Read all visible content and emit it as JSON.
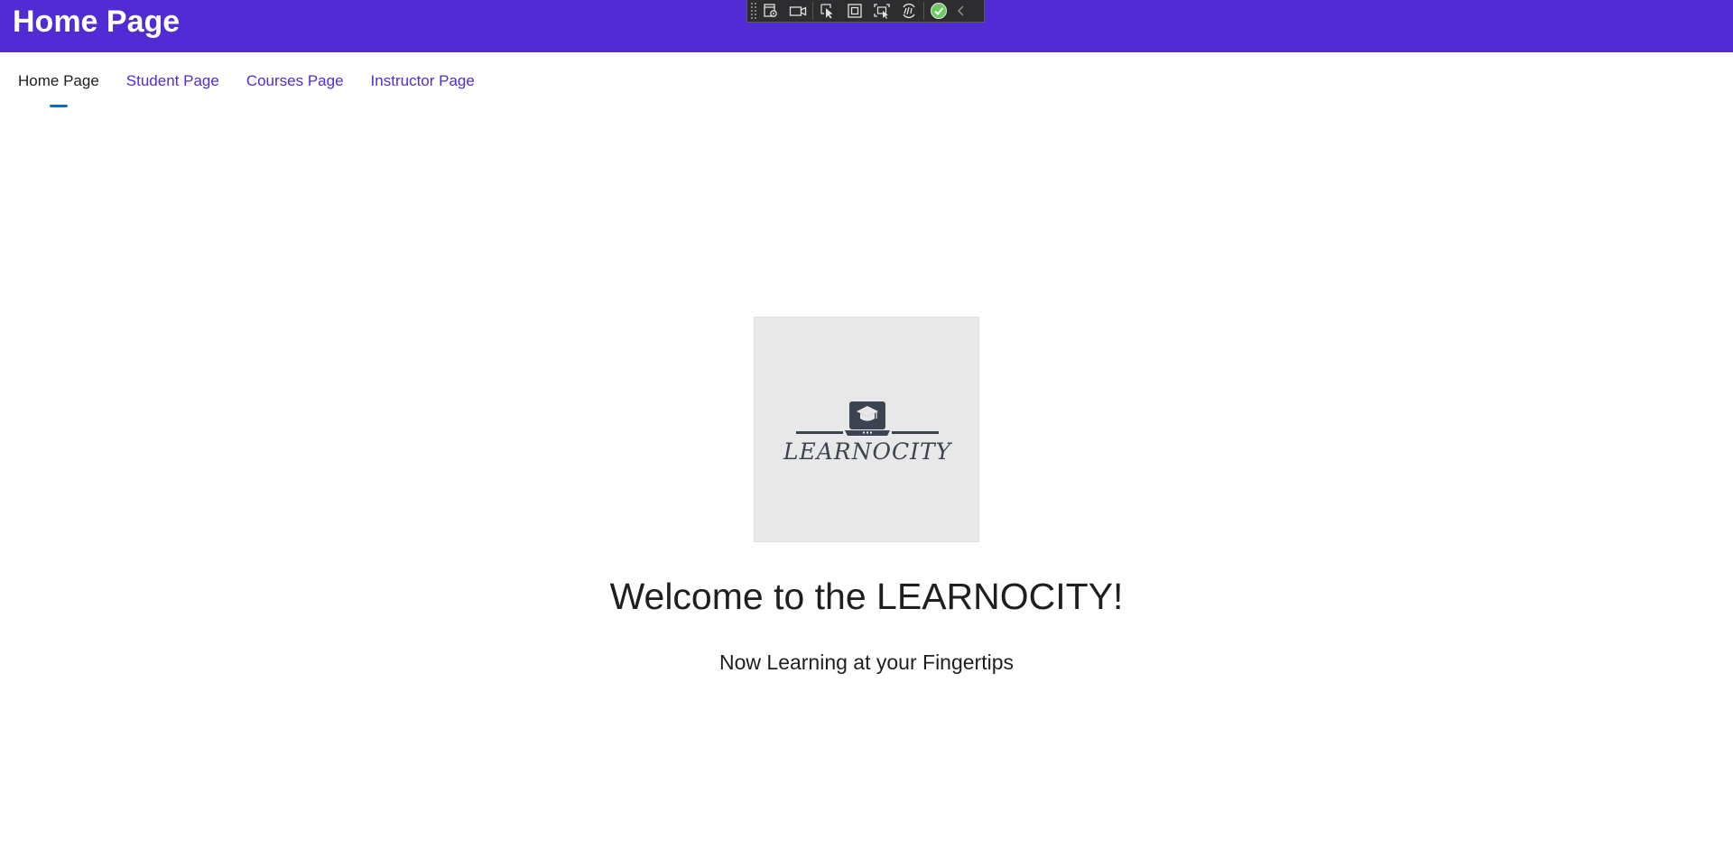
{
  "header": {
    "title": "Home Page",
    "background": "#512bd4"
  },
  "debug_toolbar": {
    "buttons": [
      {
        "icon": "live-visual-tree-icon"
      },
      {
        "icon": "record-video-icon"
      },
      {
        "icon": "select-element-icon"
      },
      {
        "icon": "display-layout-adorners-icon"
      },
      {
        "icon": "track-focus-icon"
      },
      {
        "icon": "hot-reload-icon"
      },
      {
        "icon": "status-ok-icon"
      },
      {
        "icon": "collapse-chevron-icon"
      }
    ]
  },
  "nav": {
    "tabs": [
      {
        "label": "Home Page",
        "active": true
      },
      {
        "label": "Student Page",
        "active": false
      },
      {
        "label": "Courses Page",
        "active": false
      },
      {
        "label": "Instructor Page",
        "active": false
      }
    ],
    "link_color": "#512bd4",
    "indicator_color": "#0f6cbd"
  },
  "main": {
    "logo": {
      "wordmark": "LEARNOCITY",
      "icon": "laptop-graduation-cap-icon"
    },
    "welcome": "Welcome to the LEARNOCITY!",
    "subtitle": "Now Learning at your Fingertips"
  }
}
